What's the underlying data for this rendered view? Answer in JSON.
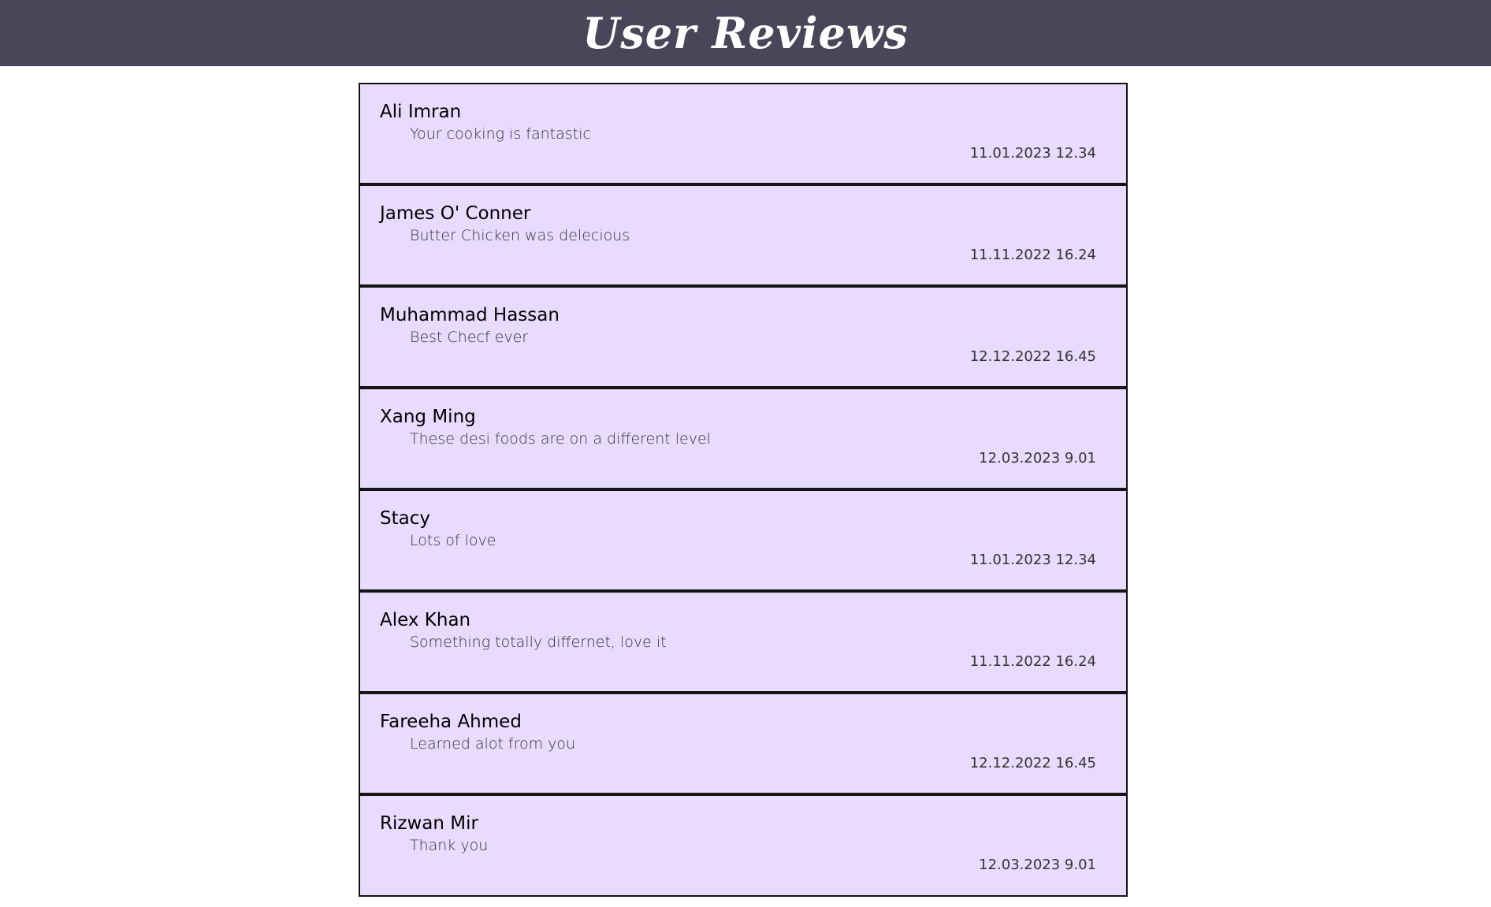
{
  "header": {
    "title": "User Reviews",
    "background_color": "#4a4559"
  },
  "reviews": [
    {
      "name": "Ali Imran",
      "text": "Your cooking is fantastic",
      "date": "11.01.2023 12.34"
    },
    {
      "name": "James O' Conner",
      "text": "Butter Chicken was delecious",
      "date": "11.11.2022 16.24"
    },
    {
      "name": "Muhammad Hassan",
      "text": "Best Checf ever",
      "date": "12.12.2022 16.45"
    },
    {
      "name": "Xang Ming",
      "text": "These desi foods are on a different level",
      "date": "12.03.2023 9.01"
    },
    {
      "name": "Stacy",
      "text": "Lots of love",
      "date": "11.01.2023 12.34"
    },
    {
      "name": "Alex Khan",
      "text": "Something totally differnet, love it",
      "date": "11.11.2022 16.24"
    },
    {
      "name": "Fareeha Ahmed",
      "text": "Learned alot from you",
      "date": "12.12.2022 16.45"
    },
    {
      "name": "Rizwan Mir",
      "text": "Thank you",
      "date": "12.03.2023 9.01"
    }
  ],
  "colors": {
    "card_background": "#e9dbfe",
    "border": "#141414"
  }
}
